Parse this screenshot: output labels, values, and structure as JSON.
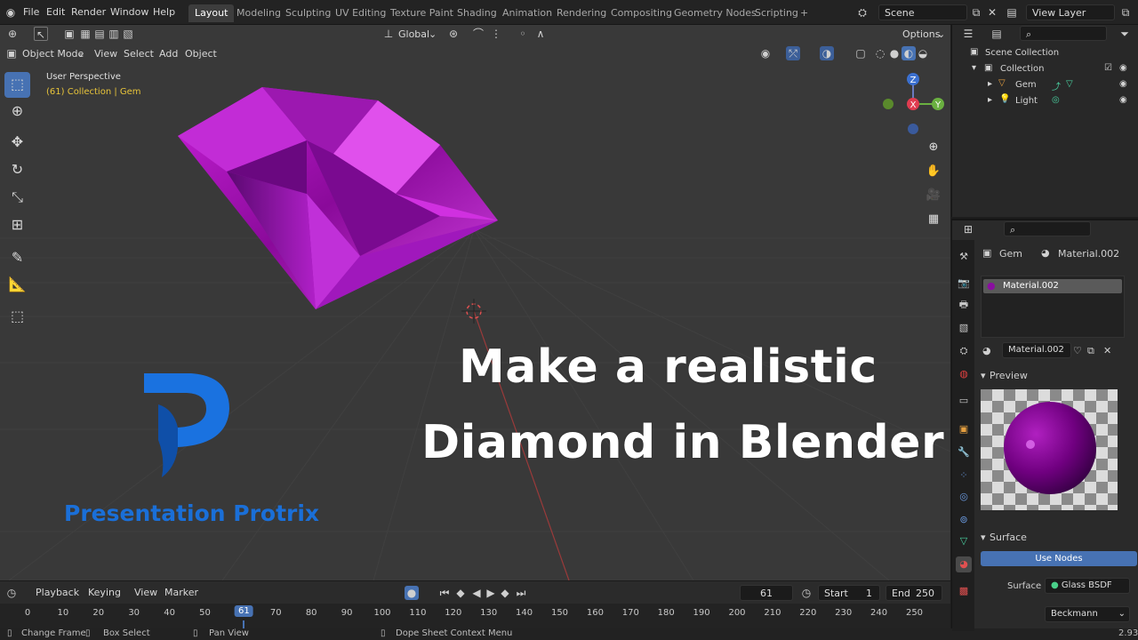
{
  "topbar": {
    "menus": [
      "File",
      "Edit",
      "Render",
      "Window",
      "Help"
    ],
    "workspaces": [
      "Layout",
      "Modeling",
      "Sculpting",
      "UV Editing",
      "Texture Paint",
      "Shading",
      "Animation",
      "Rendering",
      "Compositing",
      "Geometry Nodes",
      "Scripting"
    ],
    "add_workspace": "+",
    "scene": "Scene",
    "view_layer": "View Layer"
  },
  "viewport_toolbar": {
    "orientation": "Global",
    "options": "Options"
  },
  "viewport_header": {
    "mode": "Object Mode",
    "menus": [
      "View",
      "Select",
      "Add",
      "Object"
    ]
  },
  "viewport": {
    "perspective": "User Perspective",
    "collection_info": "(61) Collection | Gem",
    "title_line1": "Make a realistic",
    "title_line2": "Diamond in Blender",
    "logo_text": "Presentation Protrix",
    "gizmo": {
      "z": "Z",
      "x": "X",
      "y": "Y"
    }
  },
  "tools": [
    "select-box",
    "cursor",
    "move",
    "rotate",
    "scale",
    "transform",
    "annotate",
    "measure",
    "add-cube"
  ],
  "timeline": {
    "menus": [
      "Playback",
      "Keying",
      "View",
      "Marker"
    ],
    "current_frame": "61",
    "start_label": "Start",
    "start": "1",
    "end_label": "End",
    "end": "250",
    "ticks": [
      "0",
      "10",
      "20",
      "30",
      "40",
      "50",
      "61",
      "70",
      "80",
      "90",
      "100",
      "110",
      "120",
      "130",
      "140",
      "150",
      "160",
      "170",
      "180",
      "190",
      "200",
      "210",
      "220",
      "230",
      "240",
      "250"
    ]
  },
  "statusbar": {
    "items": [
      "Change Frame",
      "Box Select",
      "Pan View",
      "Dope Sheet Context Menu"
    ],
    "version": "2.93"
  },
  "outliner": {
    "scene_collection": "Scene Collection",
    "collection": "Collection",
    "items": [
      "Gem",
      "Light"
    ]
  },
  "properties": {
    "object": "Gem",
    "material_name": "Material.002",
    "slot": "Material.002",
    "preview_label": "Preview",
    "surface_label": "Surface",
    "use_nodes": "Use Nodes",
    "surface_field": "Surface",
    "surface_value": "Glass BSDF",
    "distribution": "Beckmann"
  },
  "colors": {
    "accent": "#4772b3",
    "gem": "#a010b0",
    "frame_highlight": "#4772b3",
    "logo_blue": "#1a6fd8"
  }
}
